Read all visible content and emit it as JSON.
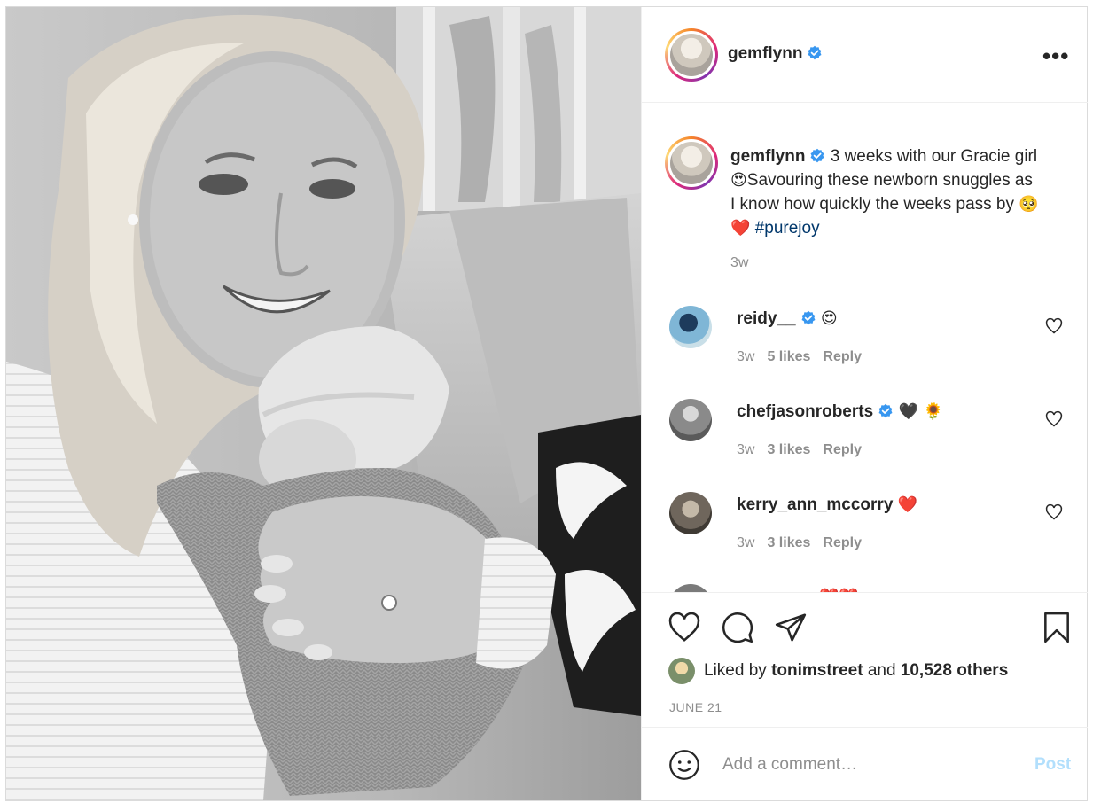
{
  "post": {
    "username": "gemflynn",
    "more_icon": "more-horizontal-icon",
    "photo_description_icon": "photo"
  },
  "caption": {
    "username": "gemflynn",
    "text_1": "3 weeks with our Gracie girl ",
    "emoji_1": "😍",
    "text_2": "Savouring these newborn snuggles as I know how quickly the weeks pass by ",
    "emoji_2": "🥺",
    "emoji_3": "❤️",
    "hashtag": "#purejoy",
    "time": "3w"
  },
  "comments": [
    {
      "username": "reidy__",
      "verified": true,
      "text": "😍",
      "time": "3w",
      "likes": "5 likes",
      "reply": "Reply"
    },
    {
      "username": "chefjasonroberts",
      "verified": true,
      "text": "🖤 🌻",
      "time": "3w",
      "likes": "3 likes",
      "reply": "Reply"
    },
    {
      "username": "kerry_ann_mccorry",
      "verified": false,
      "text": "❤️",
      "time": "3w",
      "likes": "3 likes",
      "reply": "Reply"
    },
    {
      "username": "",
      "verified": false,
      "text": "❤️❤️",
      "time": "",
      "likes": "",
      "reply": ""
    }
  ],
  "likes": {
    "prefix": "Liked by ",
    "user": "tonimstreet",
    "middle": " and ",
    "others": "10,528 others"
  },
  "date": "JUNE 21",
  "add_comment": {
    "placeholder": "Add a comment…",
    "post_label": "Post"
  },
  "colors": {
    "verified": "#3897f0",
    "hashtag": "#00376b",
    "post_disabled": "#b2dffc",
    "secondary_text": "#8e8e8e"
  }
}
